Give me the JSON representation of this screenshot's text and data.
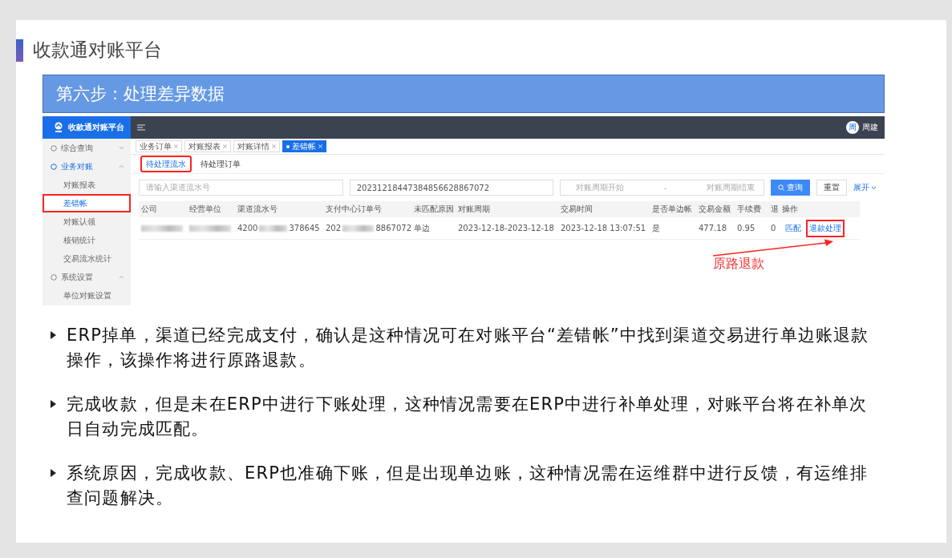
{
  "slide": {
    "title": "收款通对账平台",
    "step_banner": "第六步：处理差异数据"
  },
  "app": {
    "logo_text": "收款通对账平台",
    "user": {
      "avatar": "周",
      "name": "周建"
    },
    "sidebar": [
      {
        "label": "综合查询",
        "expanded": false,
        "selected": false,
        "highlighted": false
      },
      {
        "label": "业务对账",
        "expanded": true,
        "selected": true,
        "highlighted": false,
        "children": [
          {
            "label": "对账报表",
            "selected": false,
            "highlighted": false
          },
          {
            "label": "差错帐",
            "selected": true,
            "highlighted": true
          },
          {
            "label": "对账认领",
            "selected": false,
            "highlighted": false
          },
          {
            "label": "核销统计",
            "selected": false,
            "highlighted": false
          },
          {
            "label": "交易流水统计",
            "selected": false,
            "highlighted": false
          }
        ]
      },
      {
        "label": "系统设置",
        "expanded": true,
        "selected": false,
        "highlighted": false,
        "children": [
          {
            "label": "单位对账设置",
            "selected": false,
            "highlighted": false
          }
        ]
      }
    ],
    "open_tabs": [
      {
        "label": "业务订单",
        "selected": false
      },
      {
        "label": "对账报表",
        "selected": false
      },
      {
        "label": "对账详情",
        "selected": false
      },
      {
        "label": "差错帐",
        "selected": true
      }
    ],
    "sub_tabs": [
      {
        "label": "待处理流水",
        "selected": true,
        "highlighted": true
      },
      {
        "label": "待处理订单",
        "selected": false,
        "highlighted": false
      }
    ],
    "filters": {
      "channel_placeholder": "请输入渠道流水号",
      "order_value": "20231218447384856628867072",
      "date_start_placeholder": "对账周期开始",
      "date_separator": "-",
      "date_end_placeholder": "对账周期结束",
      "query_button": "查询",
      "reset_button": "重置",
      "expand_link": "展开"
    },
    "table": {
      "columns": [
        "公司",
        "经营单位",
        "渠道流水号",
        "支付中心订单号",
        "未匹配原因",
        "对账周期",
        "交易时间",
        "是否单边帐",
        "交易金额",
        "手续费",
        "退",
        "操作"
      ],
      "rows": [
        {
          "channel_no_start": "4200",
          "channel_no_end": "378645",
          "pay_order_start": "202",
          "pay_order_end": "8867072",
          "reason": "单边",
          "period": "2023-12-18-2023-12-18",
          "time": "2023-12-18 13:07:51",
          "one_sided": "是",
          "amount": "477.18",
          "fee": "0.95",
          "column_11": "0",
          "actions": [
            {
              "label": "匹配",
              "highlighted": false
            },
            {
              "label": "退款处理",
              "highlighted": true
            }
          ]
        }
      ]
    },
    "annotation": "原路退款"
  },
  "bullets": [
    "ERP掉单，渠道已经完成支付，确认是这种情况可在对账平台“差错帐”中找到渠道交易进行单边账退款操作，该操作将进行原路退款。",
    "完成收款，但是未在ERP中进行下账处理，这种情况需要在ERP中进行补单处理，对账平台将在补单次日自动完成匹配。",
    "系统原因，完成收款、ERP也准确下账，但是出现单边账，这种情况需在运维群中进行反馈，有运维排查问题解决。"
  ]
}
